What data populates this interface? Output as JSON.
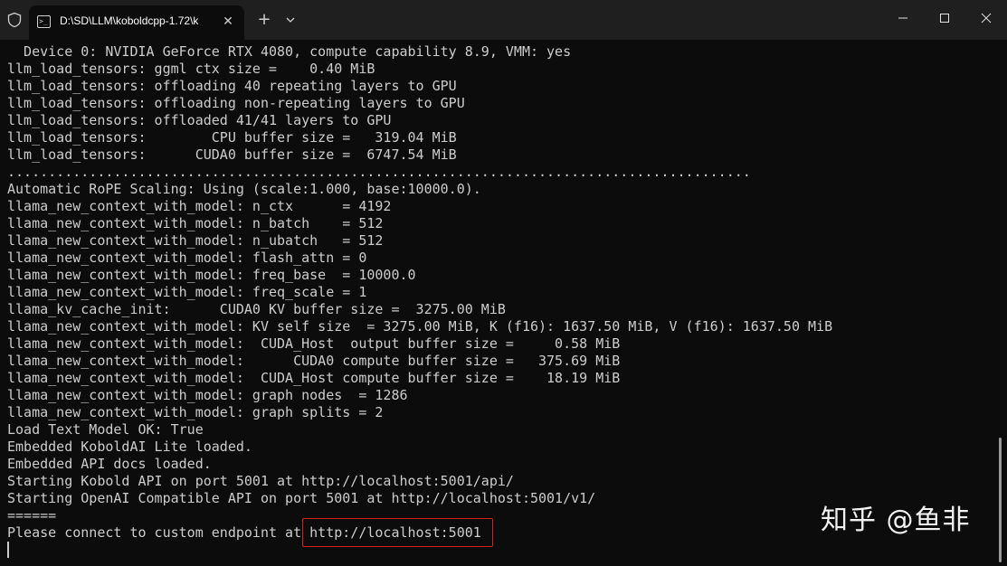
{
  "window": {
    "tab_title": "D:\\SD\\LLM\\koboldcpp-1.72\\k",
    "tab_icon_glyph": ">_",
    "new_tab_glyph": "+",
    "close_tab_glyph": "✕"
  },
  "terminal": {
    "lines": [
      "  Device 0: NVIDIA GeForce RTX 4080, compute capability 8.9, VMM: yes",
      "llm_load_tensors: ggml ctx size =    0.40 MiB",
      "llm_load_tensors: offloading 40 repeating layers to GPU",
      "llm_load_tensors: offloading non-repeating layers to GPU",
      "llm_load_tensors: offloaded 41/41 layers to GPU",
      "llm_load_tensors:        CPU buffer size =   319.04 MiB",
      "llm_load_tensors:      CUDA0 buffer size =  6747.54 MiB",
      "...........................................................................................",
      "Automatic RoPE Scaling: Using (scale:1.000, base:10000.0).",
      "llama_new_context_with_model: n_ctx      = 4192",
      "llama_new_context_with_model: n_batch    = 512",
      "llama_new_context_with_model: n_ubatch   = 512",
      "llama_new_context_with_model: flash_attn = 0",
      "llama_new_context_with_model: freq_base  = 10000.0",
      "llama_new_context_with_model: freq_scale = 1",
      "llama_kv_cache_init:      CUDA0 KV buffer size =  3275.00 MiB",
      "llama_new_context_with_model: KV self size  = 3275.00 MiB, K (f16): 1637.50 MiB, V (f16): 1637.50 MiB",
      "llama_new_context_with_model:  CUDA_Host  output buffer size =     0.58 MiB",
      "llama_new_context_with_model:      CUDA0 compute buffer size =   375.69 MiB",
      "llama_new_context_with_model:  CUDA_Host compute buffer size =    18.19 MiB",
      "llama_new_context_with_model: graph nodes  = 1286",
      "llama_new_context_with_model: graph splits = 2",
      "Load Text Model OK: True",
      "Embedded KoboldAI Lite loaded.",
      "Embedded API docs loaded.",
      "Starting Kobold API on port 5001 at http://localhost:5001/api/",
      "Starting OpenAI Compatible API on port 5001 at http://localhost:5001/v1/",
      "======",
      "Please connect to custom endpoint at http://localhost:5001"
    ]
  },
  "watermark": "知乎 @鱼非",
  "colors": {
    "titlebar": "#1f1f1f",
    "terminal_bg": "#0c0c0c",
    "text": "#cccccc",
    "highlight": "#d02020"
  }
}
